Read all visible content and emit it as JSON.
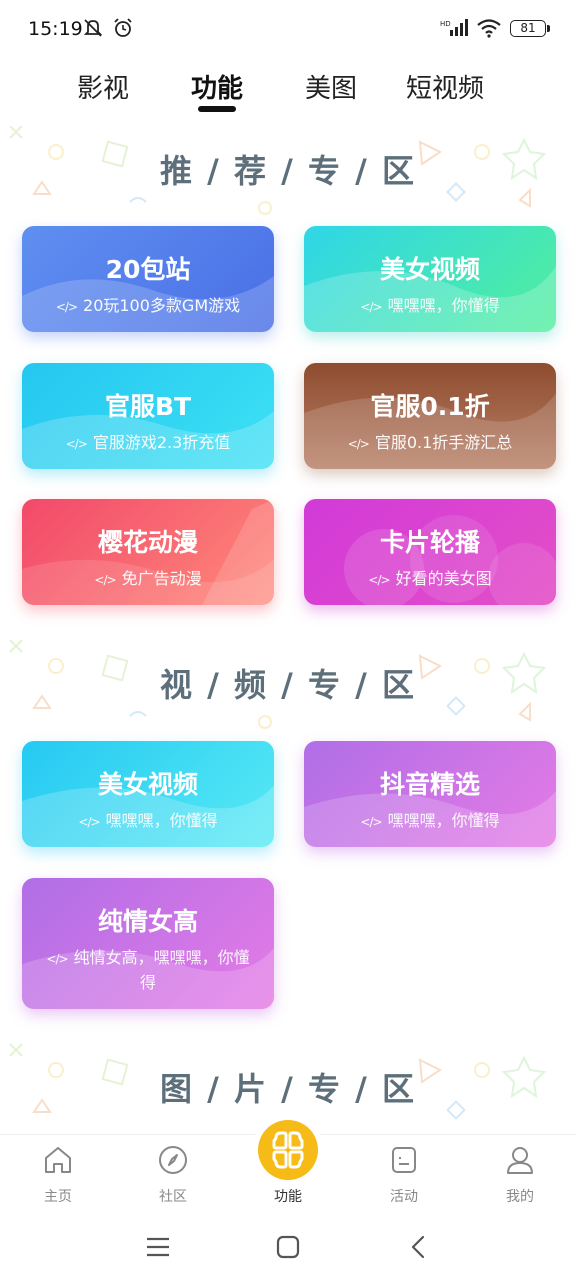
{
  "status_bar": {
    "time": "15:19",
    "battery": "81",
    "network": "HD"
  },
  "top_tabs": [
    {
      "label": "影视",
      "active": false
    },
    {
      "label": "功能",
      "active": true
    },
    {
      "label": "美图",
      "active": false
    },
    {
      "label": "短视频",
      "active": false
    }
  ],
  "sections": [
    {
      "title": "推 / 荐 / 专 / 区"
    },
    {
      "title": "视 / 频 / 专 / 区"
    },
    {
      "title": "图 / 片 / 专 / 区"
    }
  ],
  "recommend_cards": [
    {
      "title": "20包站",
      "subtitle": "20玩100多款GM游戏"
    },
    {
      "title": "美女视频",
      "subtitle": "嘿嘿嘿，你懂得"
    },
    {
      "title": "官服BT",
      "subtitle": "官服游戏2.3折充值"
    },
    {
      "title": "官服0.1折",
      "subtitle": "官服0.1折手游汇总"
    },
    {
      "title": "樱花动漫",
      "subtitle": "免广告动漫"
    },
    {
      "title": "卡片轮播",
      "subtitle": "好看的美女图"
    }
  ],
  "video_cards": [
    {
      "title": "美女视频",
      "subtitle": "嘿嘿嘿，你懂得"
    },
    {
      "title": "抖音精选",
      "subtitle": "嘿嘿嘿，你懂得"
    },
    {
      "title": "纯情女高",
      "subtitle": "纯情女高，嘿嘿嘿，你懂得"
    }
  ],
  "code_icon": "</>",
  "bottom_nav": [
    {
      "label": "主页",
      "icon": "home-icon"
    },
    {
      "label": "社区",
      "icon": "compass-icon"
    },
    {
      "label": "功能",
      "icon": "grid-icon",
      "active": true
    },
    {
      "label": "活动",
      "icon": "activity-icon"
    },
    {
      "label": "我的",
      "icon": "user-icon"
    }
  ],
  "colors": {
    "accent": "#f6bb16",
    "section_title": "#5d6f7a"
  }
}
